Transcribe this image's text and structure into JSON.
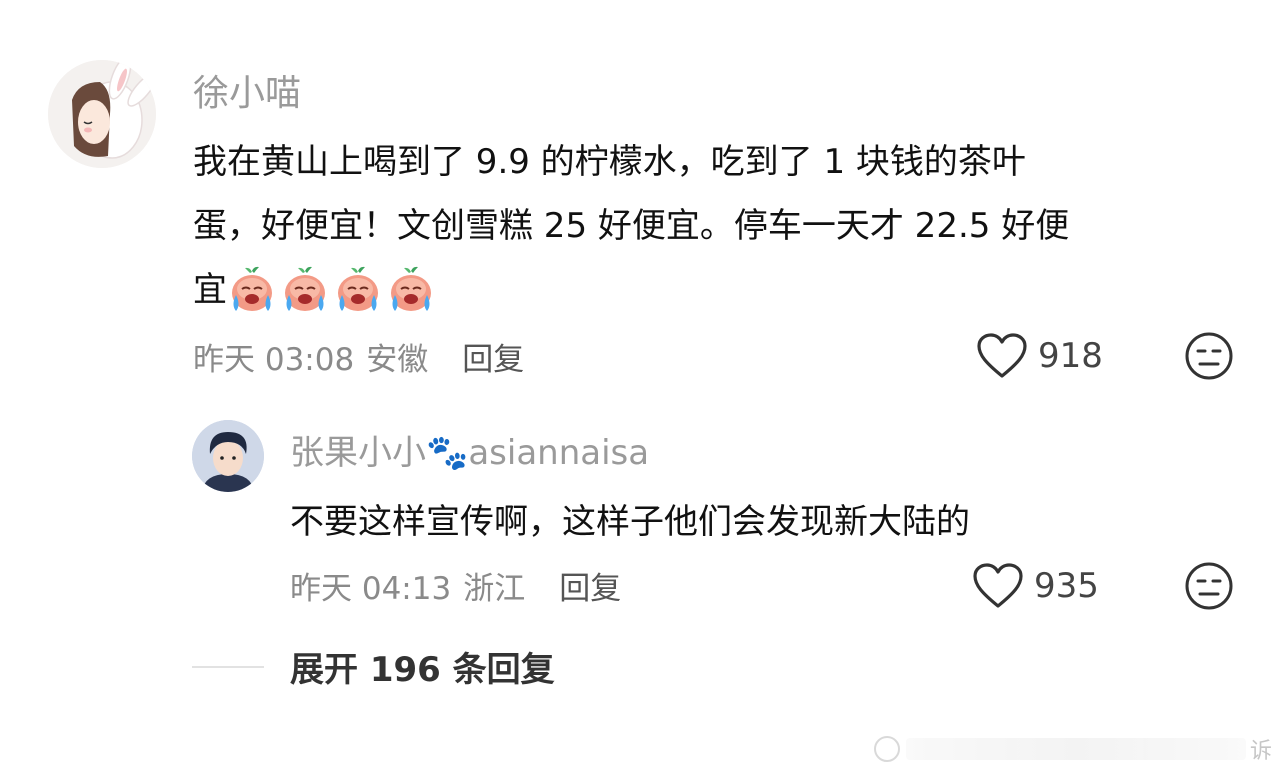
{
  "comment": {
    "author": "徐小喵",
    "text_line1": "我在黄山上喝到了 9.9 的柠檬水，吃到了 1 块钱的茶叶",
    "text_line2": "蛋，好便宜！文创雪糕 25 好便宜。停车一天才 22.5 好便",
    "text_line3": "宜",
    "emoji_names": [
      "crying-peach-emoji",
      "crying-peach-emoji",
      "crying-peach-emoji",
      "crying-peach-emoji"
    ],
    "time": "昨天 03:08",
    "location": "安徽",
    "reply_label": "回复",
    "likes": "918"
  },
  "reply": {
    "author": "张果小小🐾asiannaisa",
    "text": "不要这样宣传啊，这样子他们会发现新大陆的",
    "time": "昨天 04:13",
    "location": "浙江",
    "reply_label": "回复",
    "likes": "935"
  },
  "expand_label": "展开 196 条回复",
  "watermark_text": "诉",
  "colors": {
    "name": "#9a9a9a",
    "meta": "#8a8a8a",
    "text": "#111111"
  }
}
